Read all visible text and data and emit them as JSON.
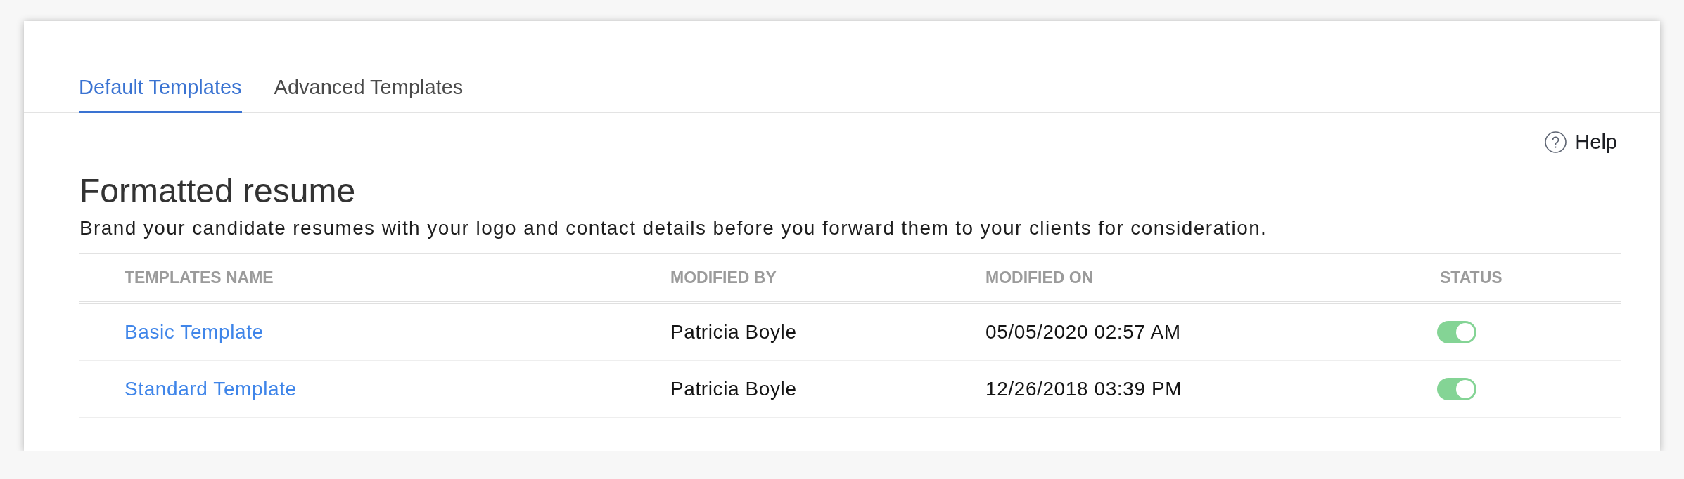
{
  "tabs": [
    {
      "label": "Default Templates",
      "selected": true
    },
    {
      "label": "Advanced Templates",
      "selected": false
    }
  ],
  "help": {
    "label": "Help"
  },
  "section": {
    "title": "Formatted resume",
    "description": "Brand your candidate resumes with your logo and contact details before you forward them to your clients for consideration."
  },
  "table": {
    "columns": [
      "TEMPLATES NAME",
      "MODIFIED BY",
      "MODIFIED ON",
      "STATUS"
    ],
    "rows": [
      {
        "name": "Basic Template",
        "modified_by": "Patricia Boyle",
        "modified_on": "05/05/2020 02:57 AM",
        "on": true
      },
      {
        "name": "Standard Template",
        "modified_by": "Patricia Boyle",
        "modified_on": "12/26/2018 03:39 PM",
        "on": true
      }
    ]
  }
}
